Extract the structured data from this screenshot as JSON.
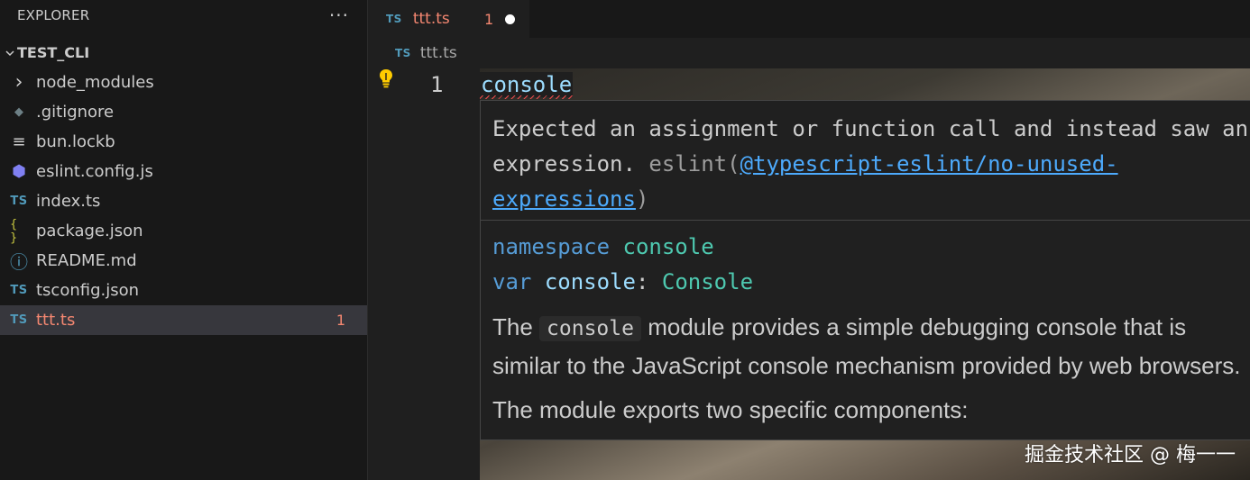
{
  "sidebar": {
    "title": "EXPLORER",
    "more_label": "···",
    "root": "TEST_CLI",
    "items": [
      {
        "name": "node_modules",
        "icon": "chevron-right-icon",
        "glyph": "›",
        "color": "#cccccc"
      },
      {
        "name": ".gitignore",
        "icon": "git-icon",
        "glyph": "◆",
        "color": "#6d8086"
      },
      {
        "name": "bun.lockb",
        "icon": "lines-icon",
        "glyph": "≡",
        "color": "#cccccc"
      },
      {
        "name": "eslint.config.js",
        "icon": "eslint-icon",
        "glyph": "⬢",
        "color": "#8080f2"
      },
      {
        "name": "index.ts",
        "icon": "typescript-icon",
        "glyph": "TS",
        "color": "#519aba"
      },
      {
        "name": "package.json",
        "icon": "json-icon",
        "glyph": "{ }",
        "color": "#cbcb41"
      },
      {
        "name": "README.md",
        "icon": "info-icon",
        "glyph": "ⓘ",
        "color": "#519aba"
      },
      {
        "name": "tsconfig.json",
        "icon": "tsconfig-icon",
        "glyph": "TS",
        "color": "#519aba"
      },
      {
        "name": "ttt.ts",
        "icon": "typescript-icon",
        "glyph": "TS",
        "color": "#519aba",
        "count": "1",
        "active": true
      }
    ]
  },
  "tab": {
    "icon_label": "TS",
    "name": "ttt.ts",
    "count": "1"
  },
  "breadcrumb": {
    "icon_label": "TS",
    "name": "ttt.ts"
  },
  "editor": {
    "line_number": "1",
    "code": "console"
  },
  "hover": {
    "diag_line1": "Expected an assignment or function call and instead saw an",
    "diag_line2_text": "expression.",
    "diag_source": "eslint(",
    "diag_rule_part1": "@typescript-eslint/no-unused-",
    "diag_rule_part2": "expressions",
    "diag_close": ")",
    "sig1_kw": "namespace",
    "sig1_name": "console",
    "sig2_kw": "var",
    "sig2_name": "console",
    "sig2_colon": ":",
    "sig2_type": "Console",
    "doc_p1_pre": "The",
    "doc_p1_code": "console",
    "doc_p1_post": "module provides a simple debugging console that is",
    "doc_p1_line2": "similar to the JavaScript console mechanism provided by web browsers.",
    "doc_p2": "The module exports two specific components:"
  },
  "watermark": "掘金技术社区 @ 梅一一",
  "colors": {
    "error": "#f48771",
    "accent": "#519aba",
    "link": "#4daafc"
  }
}
